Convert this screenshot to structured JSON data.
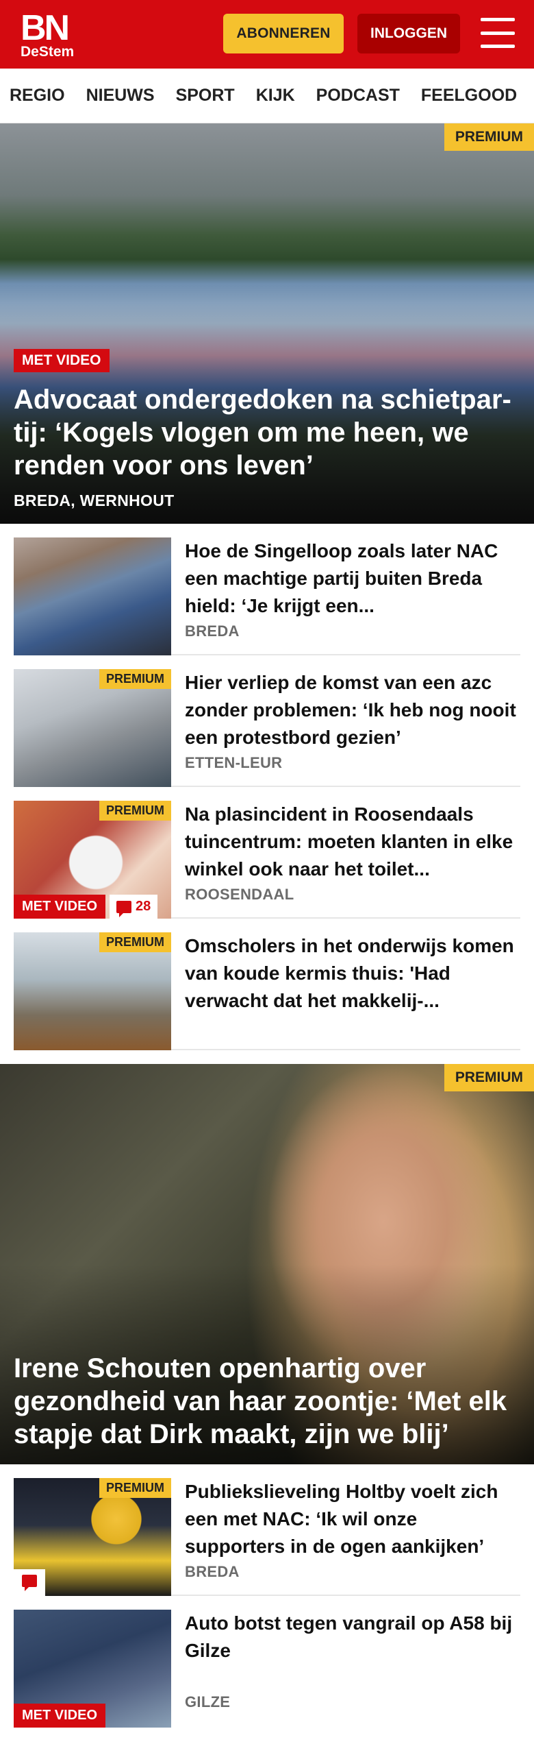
{
  "header": {
    "logo_main": "BN",
    "logo_sub": "DeStem",
    "subscribe_label": "ABONNEREN",
    "login_label": "INLOGGEN"
  },
  "nav": [
    "REGIO",
    "NIEUWS",
    "SPORT",
    "KIJK",
    "PODCAST",
    "FEELGOOD"
  ],
  "hero1": {
    "premium": "PREMIUM",
    "video_label": "MET VIDEO",
    "title": "Advocaat ondergedoken na schietpar-tij: ‘Kogels vlogen om me heen, we renden voor ons leven’",
    "location": "BREDA, WERNHOUT"
  },
  "list1": [
    {
      "title": "Hoe de Singelloop zoals later NAC een machtige partij buiten Breda hield: ‘Je krijgt een...",
      "location": "BREDA"
    },
    {
      "premium": "PREMIUM",
      "title": "Hier verliep de komst van een azc zonder problemen: ‘Ik heb nog nooit een protestbord gezien’",
      "location": "ETTEN-LEUR"
    },
    {
      "premium": "PREMIUM",
      "video_label": "MET VIDEO",
      "comments": "28",
      "title": "Na plasincident in Roosendaals tuincentrum: moeten klanten in elke winkel ook naar het toilet...",
      "location": "ROOSENDAAL"
    },
    {
      "premium": "PREMIUM",
      "title": "Omscholers in het onderwijs komen van koude kermis thuis: 'Had verwacht dat het makkelij-...",
      "location": ""
    }
  ],
  "hero2": {
    "premium": "PREMIUM",
    "title": "Irene Schouten openhartig over gezondheid van haar zoontje: ‘Met elk stapje dat Dirk maakt, zijn we blij’"
  },
  "list2": [
    {
      "premium": "PREMIUM",
      "title": "Publiekslieveling Holtby voelt zich een met NAC: ‘Ik wil onze supporters in de ogen aankijken’",
      "location": "BREDA"
    },
    {
      "video_label": "MET VIDEO",
      "title": "Auto botst tegen vangrail op A58 bij Gilze",
      "location": "GILZE"
    }
  ],
  "colors": {
    "brand_red": "#d40a10",
    "premium_yellow": "#f5c12e",
    "login_dark_red": "#a90000"
  }
}
